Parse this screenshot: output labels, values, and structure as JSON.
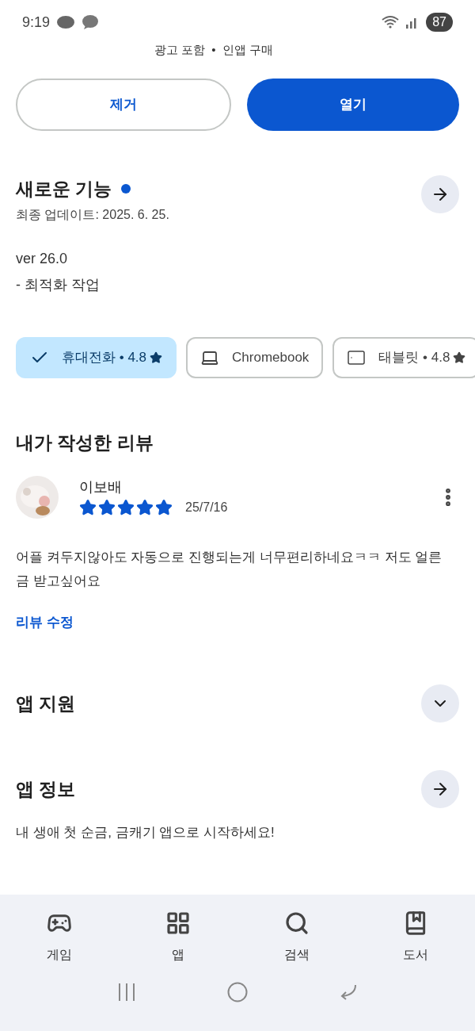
{
  "status_bar": {
    "time": "9:19",
    "battery": "87"
  },
  "tagline": "광고 포함  •  인앱 구매",
  "buttons": [
    {
      "label": "제거",
      "kind": "outline"
    },
    {
      "label": "열기",
      "kind": "filled"
    }
  ],
  "whats_new": {
    "title": "새로운 기능",
    "updated": "최종 업데이트: 2025. 6. 25.",
    "lines": [
      "ver 26.0",
      "- 최적화 작업"
    ]
  },
  "devices": [
    {
      "label": "휴대전화 • 4.8",
      "kind": "phone",
      "selected": true,
      "rated": true
    },
    {
      "label": "Chromebook",
      "kind": "laptop",
      "selected": false,
      "rated": false
    },
    {
      "label": "태블릿 • 4.8",
      "kind": "tablet",
      "selected": false,
      "rated": true
    }
  ],
  "my_review": {
    "title": "내가 작성한 리뷰",
    "author": "이보배",
    "stars": 5,
    "date": "25/7/16",
    "text": "어플 켜두지않아도 자동으로 진행되는게 너무편리하네요ㅋㅋ 저도 얼른 금 받고싶어요",
    "edit": "리뷰 수정"
  },
  "app_support": {
    "title": "앱 지원",
    "expanded": false
  },
  "app_info": {
    "title": "앱 정보",
    "description": "내 생애 첫 순금, 금캐기 앱으로 시작하세요!"
  },
  "bottom_nav": [
    {
      "label": "게임",
      "kind": "games"
    },
    {
      "label": "앱",
      "kind": "apps"
    },
    {
      "label": "검색",
      "kind": "search"
    },
    {
      "label": "도서",
      "kind": "books"
    }
  ]
}
